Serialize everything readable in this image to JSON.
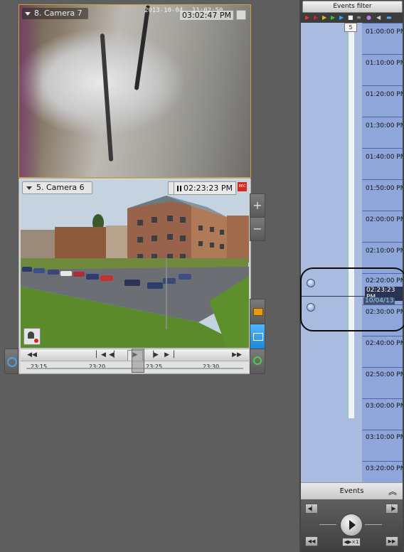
{
  "camera_top": {
    "title": "8. Camera 7",
    "osd_date": "2013-10-04",
    "osd_time": "11:02:50",
    "time": "03:02:47 PM"
  },
  "camera_bottom": {
    "title": "5. Camera 6",
    "time": "02:23:23 PM",
    "rec_label": "REC",
    "timeline_ticks": [
      "23:15",
      "23:20",
      "23:25",
      "23:30"
    ]
  },
  "side_buttons": {
    "zoom_in": "+",
    "zoom_out": "−"
  },
  "events_filter": {
    "label": "Events filter",
    "badge": "5"
  },
  "timeline": {
    "labels": [
      "01:00:00 PM",
      "01:10:00 PM",
      "01:20:00 PM",
      "01:30:00 PM",
      "01:40:00 PM",
      "01:50:00 PM",
      "02:00:00 PM",
      "02:10:00 PM",
      "02:20:00 PM",
      "02:30:00 PM",
      "02:40:00 PM",
      "02:50:00 PM",
      "03:00:00 PM",
      "03:10:00 PM",
      "03:20:00 PM"
    ],
    "current_time": "02:23:23 PM",
    "current_date": "10/04/13"
  },
  "events_panel": {
    "label": "Events",
    "speed": "◀▶×1"
  },
  "colors": {
    "timeline_bg": "#93a9d7",
    "accent": "#c9a23a",
    "rec": "#d8281c"
  }
}
